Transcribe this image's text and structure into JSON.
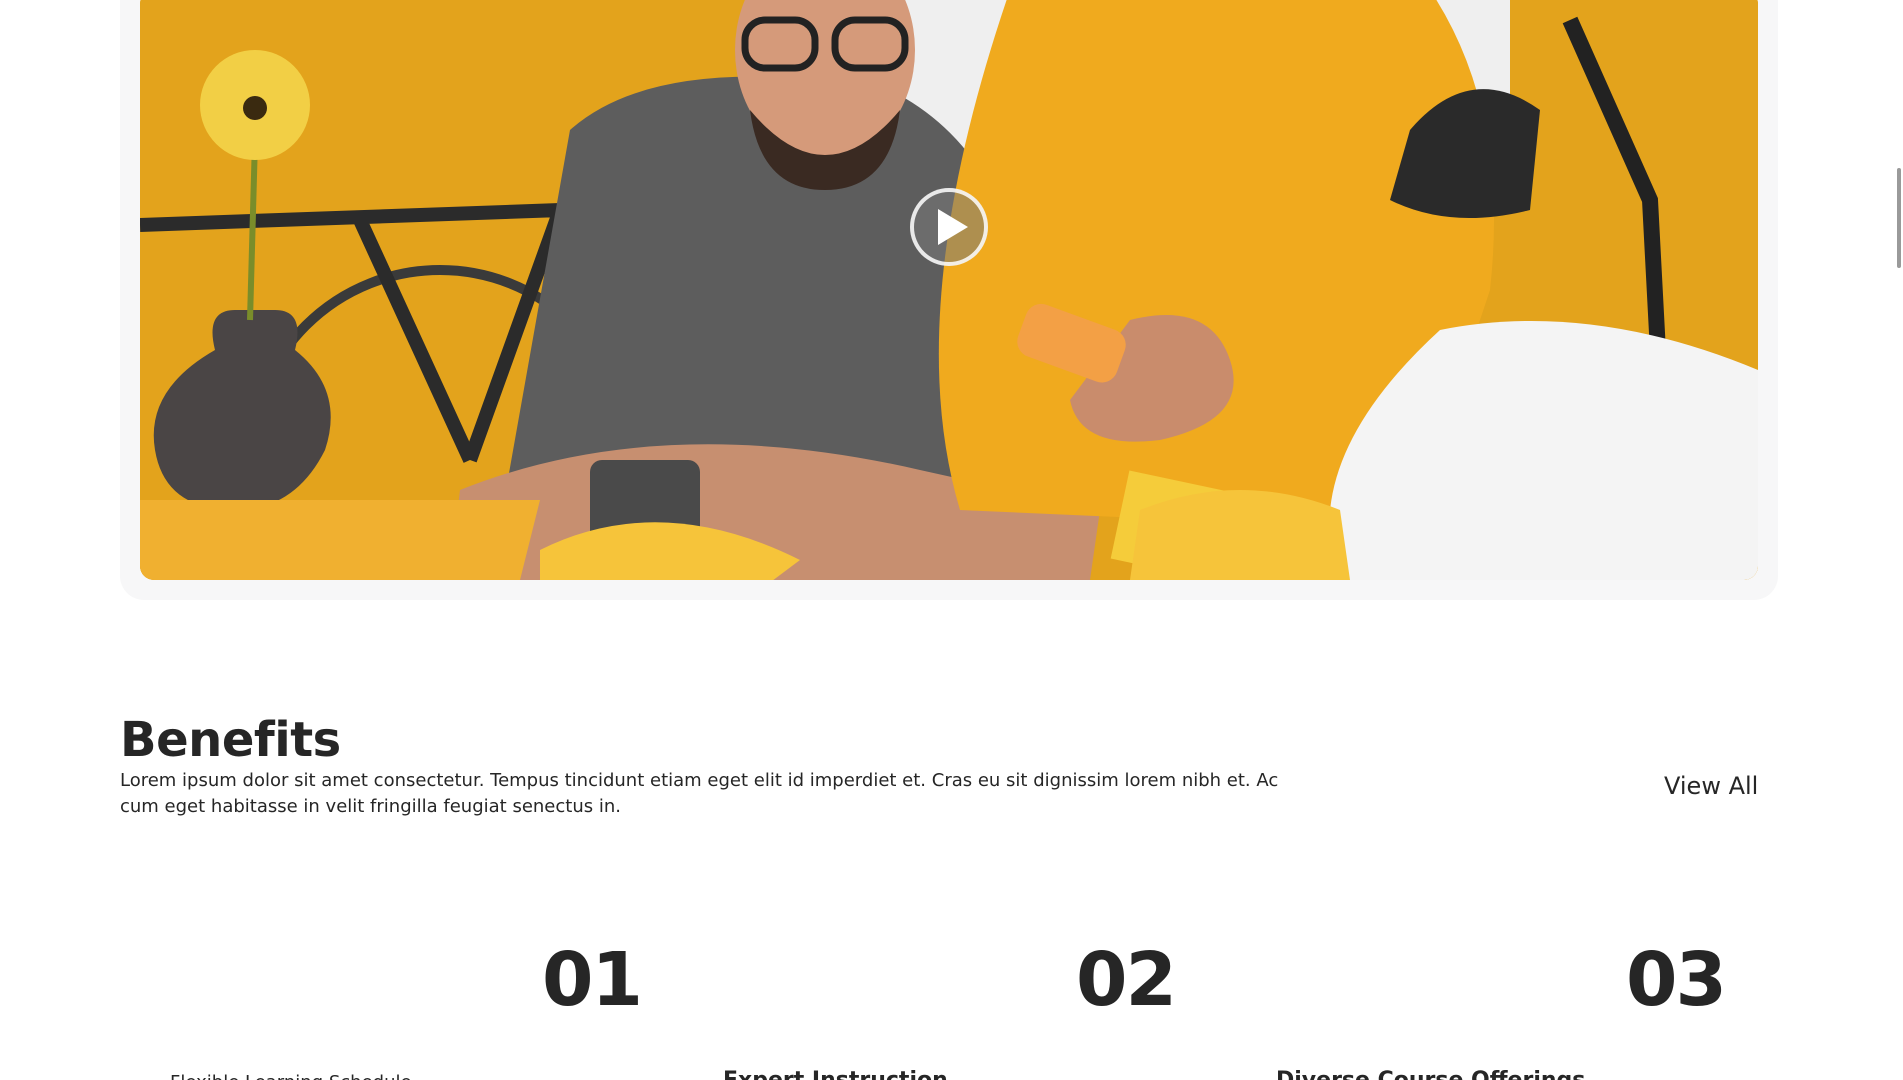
{
  "video": {
    "play_icon": "play-icon"
  },
  "benefits": {
    "title": "Benefits",
    "description": "Lorem ipsum dolor sit amet consectetur. Tempus tincidunt etiam eget elit id imperdiet et. Cras eu sit dignissim lorem nibh et. Ac cum eget habitasse in velit fringilla feugiat senectus in.",
    "view_all_label": "View All",
    "items": [
      {
        "number": "01",
        "title": "Flexible Learning Schedule"
      },
      {
        "number": "02",
        "title": "Expert Instruction"
      },
      {
        "number": "03",
        "title": "Diverse Course Offerings"
      }
    ]
  },
  "colors": {
    "accent": "#E8A520",
    "text": "#262626",
    "card_bg": "#F7F7F8"
  }
}
